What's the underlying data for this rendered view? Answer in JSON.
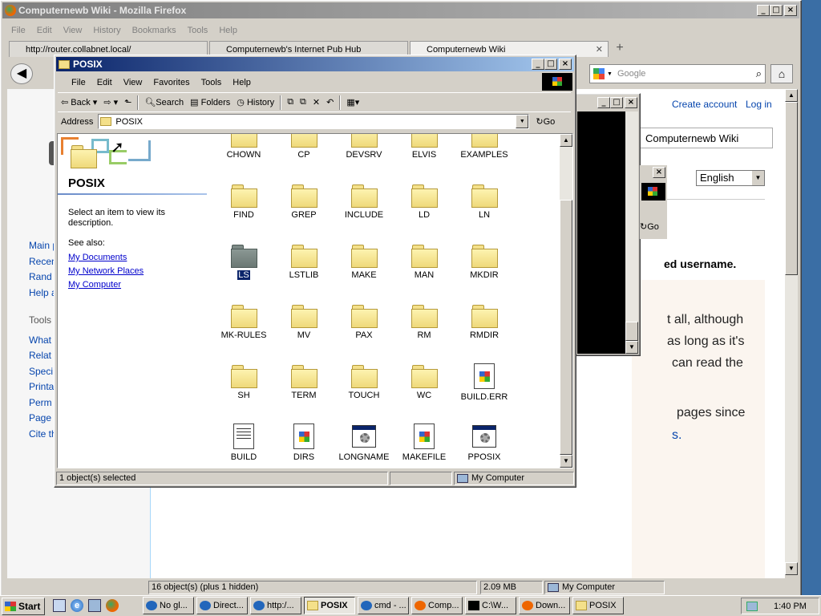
{
  "firefox": {
    "title": "Computernewb Wiki - Mozilla Firefox",
    "menu": [
      "File",
      "Edit",
      "View",
      "History",
      "Bookmarks",
      "Tools",
      "Help"
    ],
    "tabs": [
      {
        "label": "http://router.collabnet.local/"
      },
      {
        "label": "Computernewb's Internet Pub Hub"
      },
      {
        "label": "Computernewb Wiki"
      }
    ],
    "search_placeholder": "Google",
    "wiki": {
      "create_account": "Create account",
      "login": "Log in",
      "search_value": "Computernewb Wiki",
      "language": "English",
      "sidebar": [
        "Main p",
        "Recen",
        "Rand",
        "Help a"
      ],
      "tools_heading": "Tools",
      "tools": [
        "What",
        "Relat",
        "Speci",
        "Printa",
        "Perm",
        "Page",
        "Cite th"
      ],
      "text_fragments": [
        "ed username.",
        "t all, although",
        "as long as it's",
        "can read the",
        "pages since",
        "s."
      ]
    }
  },
  "explorer": {
    "title": "POSIX",
    "menu": [
      "File",
      "Edit",
      "View",
      "Favorites",
      "Tools",
      "Help"
    ],
    "toolbar": {
      "back": "Back",
      "search": "Search",
      "folders": "Folders",
      "history": "History"
    },
    "address_label": "Address",
    "address_value": "POSIX",
    "go": "Go",
    "panel": {
      "heading": "POSIX",
      "desc": "Select an item to view its description.",
      "see_also": "See also:",
      "links": [
        "My Documents",
        "My Network Places",
        "My Computer"
      ]
    },
    "rows": [
      [
        "CHOWN",
        "CP",
        "DEVSRV",
        "ELVIS",
        "EXAMPLES"
      ],
      [
        "FIND",
        "GREP",
        "INCLUDE",
        "LD",
        "LN"
      ],
      [
        "LS",
        "LSTLIB",
        "MAKE",
        "MAN",
        "MKDIR"
      ],
      [
        "MK-RULES",
        "MV",
        "PAX",
        "RM",
        "RMDIR"
      ],
      [
        "SH",
        "TERM",
        "TOUCH",
        "WC",
        "BUILD.ERR"
      ],
      [
        "BUILD",
        "DIRS",
        "LONGNAME",
        "MAKEFILE",
        "PPOSIX"
      ]
    ],
    "selected": "LS",
    "status_left": "1 object(s) selected",
    "status_right": "My Computer"
  },
  "background_explorer": {
    "status_left": "16 object(s) (plus 1 hidden)",
    "status_size": "2.09 MB",
    "status_right": "My Computer",
    "go": "Go"
  },
  "taskbar": {
    "start": "Start",
    "items": [
      "No gl...",
      "Direct...",
      "http:/...",
      "POSIX",
      "cmd - ...",
      "Comp...",
      "C:\\W...",
      "Down...",
      "POSIX"
    ],
    "active_index": 3,
    "clock": "1:40 PM"
  }
}
